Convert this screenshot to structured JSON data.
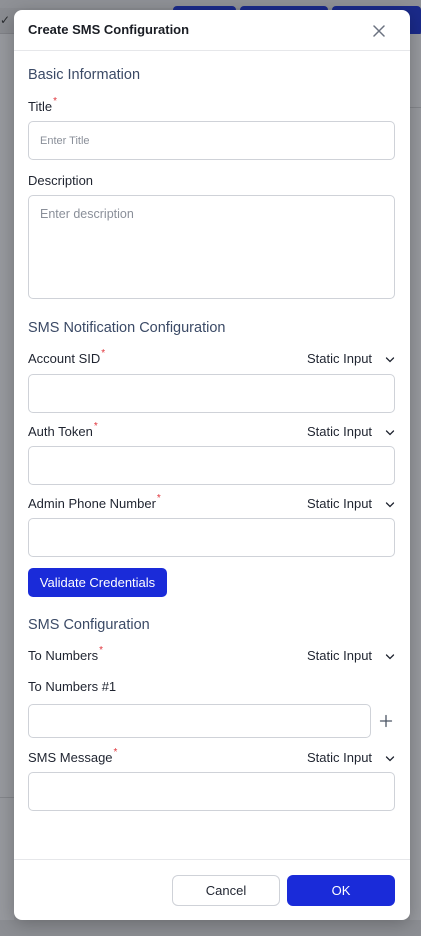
{
  "modal": {
    "title": "Create SMS Configuration"
  },
  "basic_information": {
    "section_title": "Basic Information",
    "title_label": "Title",
    "title_placeholder": "Enter Title",
    "title_value": "",
    "description_label": "Description",
    "description_placeholder": "Enter description",
    "description_value": ""
  },
  "sms_notification": {
    "section_title": "SMS Notification Configuration",
    "fields": [
      {
        "label": "Account SID",
        "mode": "Static Input",
        "value": ""
      },
      {
        "label": "Auth Token",
        "mode": "Static Input",
        "value": ""
      },
      {
        "label": "Admin Phone Number",
        "mode": "Static Input",
        "value": ""
      }
    ],
    "validate_label": "Validate Credentials"
  },
  "sms_configuration": {
    "section_title": "SMS Configuration",
    "to_numbers_label": "To Numbers",
    "to_numbers_mode": "Static Input",
    "to_numbers_item_label": "To Numbers #1",
    "to_numbers_item_value": "",
    "message_label": "SMS Message",
    "message_mode": "Static Input",
    "message_value": ""
  },
  "footer": {
    "cancel_label": "Cancel",
    "ok_label": "OK"
  },
  "background": {
    "check_glyph": "✓"
  },
  "colors": {
    "primary": "#1a2bd9",
    "required": "#e0343b",
    "section_title": "#3b4a66"
  }
}
